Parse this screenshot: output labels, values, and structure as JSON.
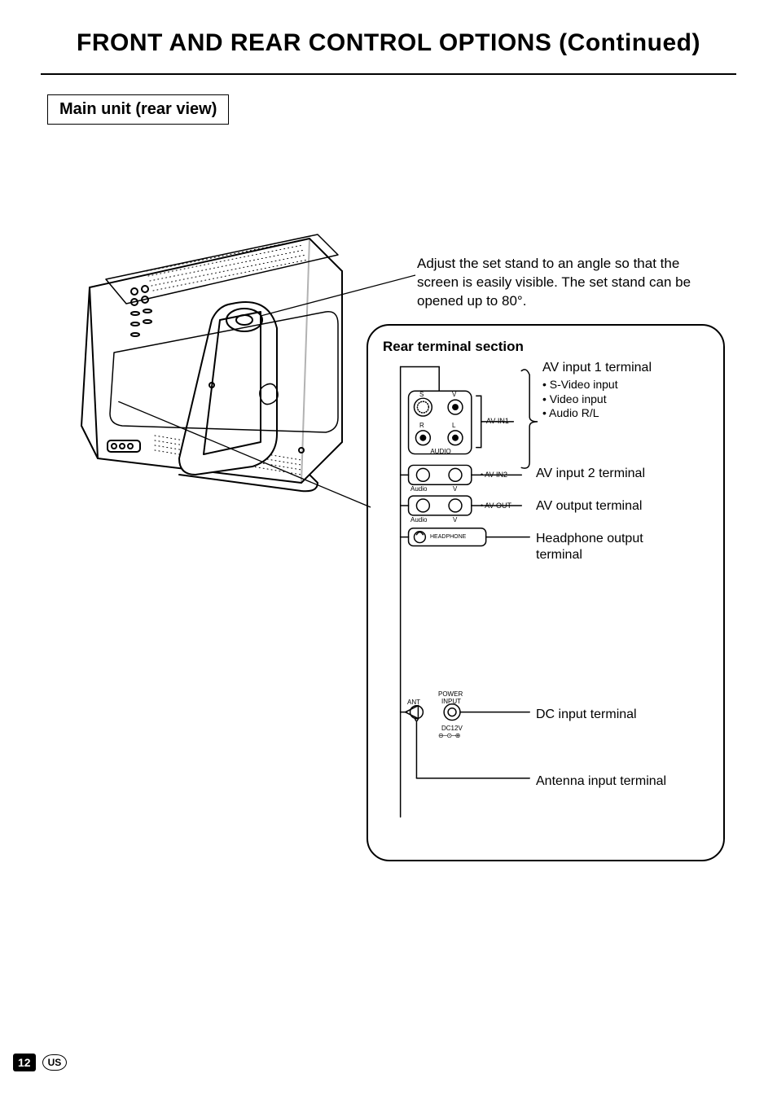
{
  "title": "FRONT AND REAR CONTROL OPTIONS (Continued)",
  "subheading": "Main unit (rear view)",
  "standText": "Adjust the set stand to an angle so that the screen is easily visible. The set stand can be opened up to 80°.",
  "panel": {
    "title": "Rear terminal section",
    "avin1": {
      "label": "AV input 1 terminal",
      "sub1": "S-Video input",
      "sub2": "Video input",
      "sub3": "Audio R/L"
    },
    "avin2": "AV input 2 terminal",
    "avout": "AV output terminal",
    "headphone": "Headphone output terminal",
    "dc": "DC input terminal",
    "ant": "Antenna input terminal",
    "jackLabels": {
      "s": "S",
      "v": "V",
      "r": "R",
      "l": "L",
      "audio": "AUDIO",
      "avin1": "AV-IN1",
      "avin2Mark": "• AV-IN2",
      "avoutMark": "• AV-OUT",
      "audio2": "Audio",
      "v2": "V",
      "audio3": "Audio",
      "v3": "V",
      "headphoneLbl": "HEADPHONE",
      "ant": "ANT",
      "power": "POWER",
      "input": "INPUT",
      "dc12v": "DC12V"
    }
  },
  "footer": {
    "page": "12",
    "region": "US"
  }
}
